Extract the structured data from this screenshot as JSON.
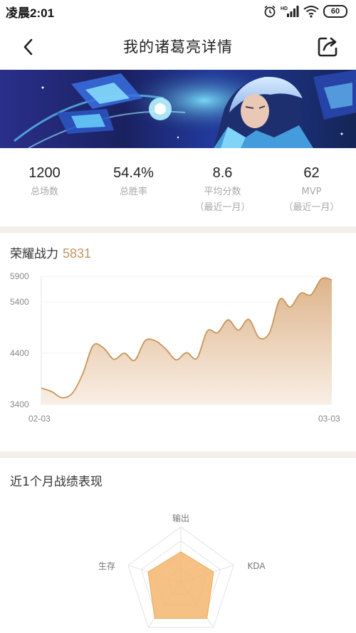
{
  "status_bar": {
    "time": "凌晨2:01",
    "hd_label": "HD",
    "battery": "60",
    "icons": [
      "alarm-icon",
      "signal-icon",
      "wifi-icon",
      "battery-icon"
    ]
  },
  "header": {
    "title": "我的诸葛亮详情",
    "back_icon": "chevron-left-icon",
    "share_icon": "share-icon"
  },
  "stats": [
    {
      "value": "1200",
      "label": "总场数",
      "sub": ""
    },
    {
      "value": "54.4%",
      "label": "总胜率",
      "sub": ""
    },
    {
      "value": "8.6",
      "label": "平均分数",
      "sub": "（最近一月）"
    },
    {
      "value": "62",
      "label": "MVP",
      "sub": "（最近一月）"
    }
  ],
  "power": {
    "title": "荣耀战力",
    "value": "5831"
  },
  "chart_data": {
    "type": "area",
    "title": "荣耀战力",
    "y_ticks": [
      3400,
      4400,
      5400,
      5900
    ],
    "y_tick_labels": [
      "3400",
      "4400",
      "5400",
      "5900"
    ],
    "ylim": [
      3400,
      5900
    ],
    "x_labels": [
      "02-03",
      "03-03"
    ],
    "values": [
      3720,
      3650,
      3530,
      3620,
      4000,
      4550,
      4500,
      4280,
      4400,
      4260,
      4640,
      4640,
      4480,
      4270,
      4410,
      4300,
      4830,
      4800,
      5050,
      4850,
      5060,
      4700,
      4800,
      5450,
      5300,
      5570,
      5540,
      5850,
      5831
    ],
    "line_color": "#c8955a",
    "fill_top_color": "#ddb48a",
    "fill_bottom_color": "#f9efe5"
  },
  "month": {
    "title": "近1个月战绩表现",
    "radar_axes": [
      "输出",
      "KDA",
      "生存"
    ],
    "fill_color": "#f5b66e"
  },
  "colors": {
    "accent": "#c19561",
    "divider": "#f4efea"
  }
}
